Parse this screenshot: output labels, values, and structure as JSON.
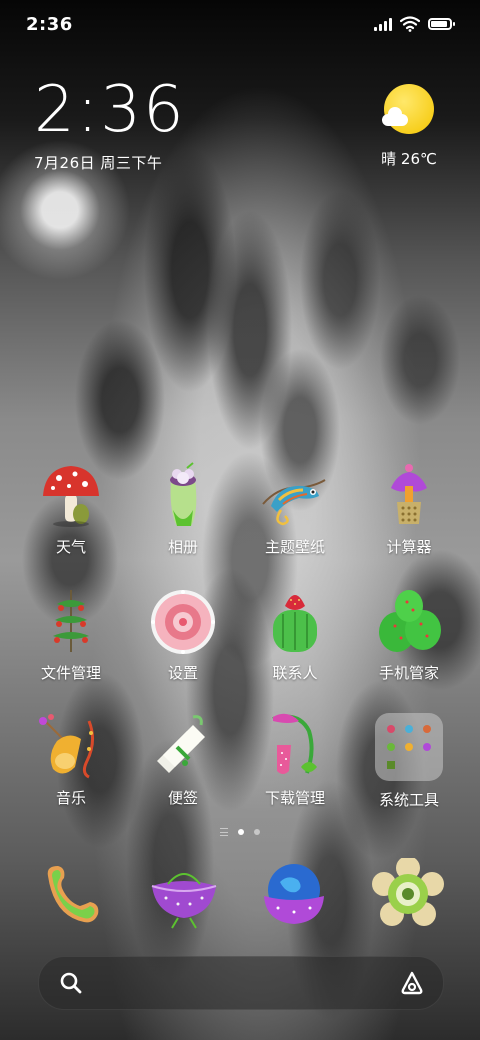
{
  "status_bar": {
    "time": "2:36",
    "icons": [
      "signal-icon",
      "wifi-icon",
      "battery-icon"
    ],
    "battery_level": 0.9
  },
  "clock_widget": {
    "time": "2:36",
    "date": "7月26日 周三下午"
  },
  "weather_widget": {
    "icon": "sunny-cloud-icon",
    "text": "晴 26℃"
  },
  "apps": [
    {
      "label": "天气",
      "icon": "mushroom-icon"
    },
    {
      "label": "相册",
      "icon": "pitcher-plant-icon"
    },
    {
      "label": "主题壁纸",
      "icon": "chameleon-icon"
    },
    {
      "label": "计算器",
      "icon": "purple-flower-pot-icon"
    },
    {
      "label": "文件管理",
      "icon": "vine-tower-icon"
    },
    {
      "label": "设置",
      "icon": "pink-flower-icon"
    },
    {
      "label": "联系人",
      "icon": "cactus-strawberry-icon"
    },
    {
      "label": "手机管家",
      "icon": "cactus-cluster-icon"
    },
    {
      "label": "音乐",
      "icon": "horn-flower-icon"
    },
    {
      "label": "便签",
      "icon": "white-bouquet-icon"
    },
    {
      "label": "下载管理",
      "icon": "hanging-flower-icon"
    },
    {
      "label": "系统工具",
      "icon": "folder-icon"
    }
  ],
  "page_indicator": {
    "pages": 2,
    "current": 1
  },
  "dock": [
    {
      "name": "phone",
      "icon": "phone-icon"
    },
    {
      "name": "messages",
      "icon": "purple-bowl-icon"
    },
    {
      "name": "browser",
      "icon": "globe-icon"
    },
    {
      "name": "camera",
      "icon": "green-flower-camera-icon"
    }
  ],
  "search_bar": {
    "left_icon": "search-icon",
    "right_icon": "assistant-icon"
  },
  "colors": {
    "sun": "#f4c500",
    "text": "#ffffff"
  }
}
